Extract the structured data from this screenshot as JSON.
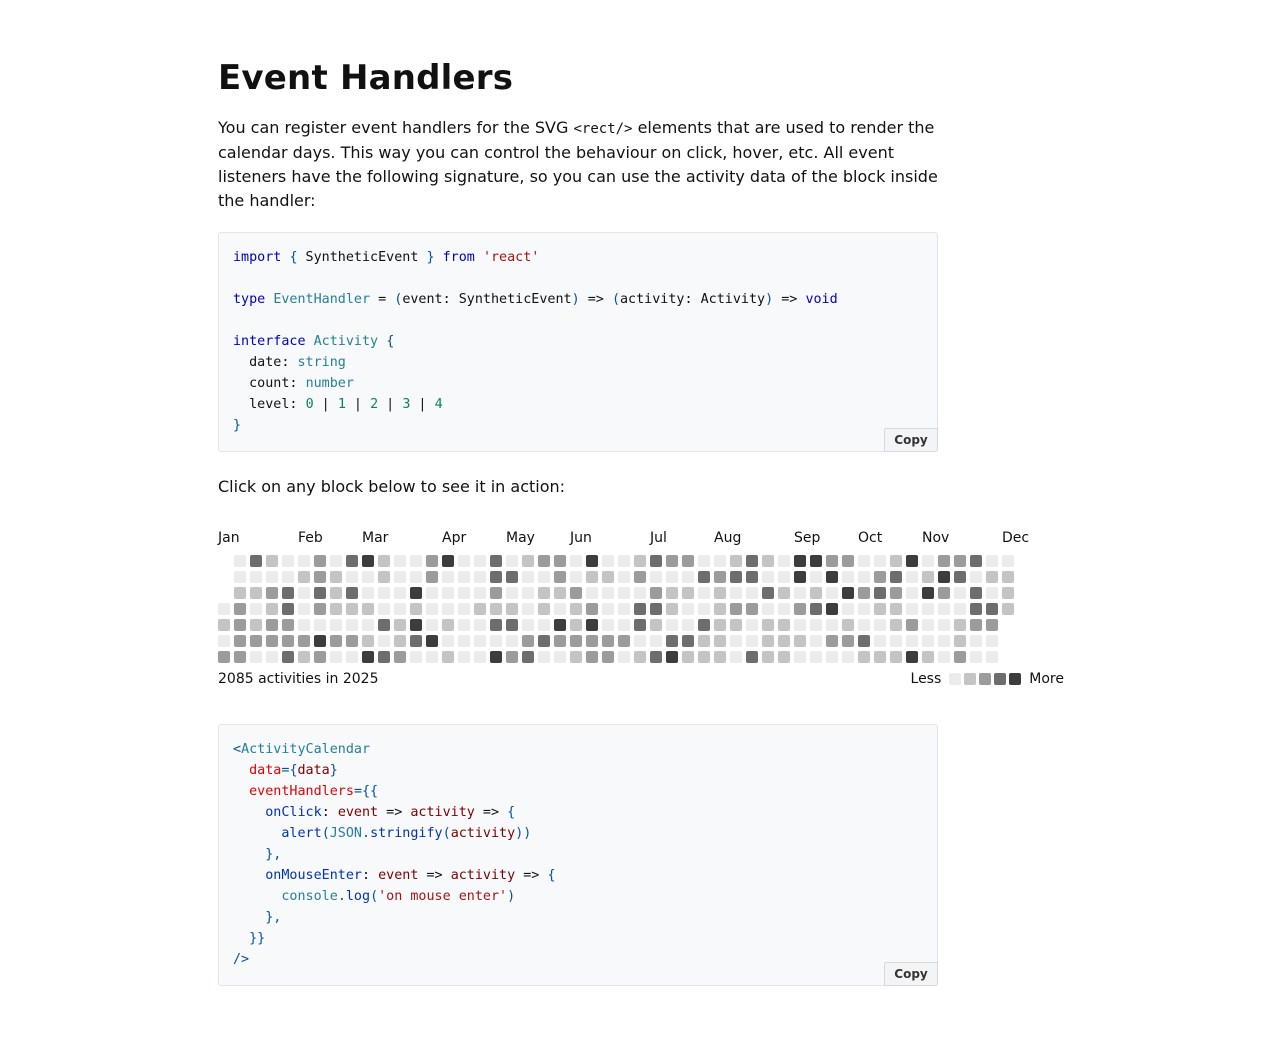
{
  "page": {
    "title": "Event Handlers",
    "intro_part1": "You can register event handlers for the SVG ",
    "intro_code": "<rect/>",
    "intro_part2": " elements that are used to render the calendar days. This way you can control the behaviour on click, hover, etc. All event listeners have the following signature, so you can use the activity data of the block inside the handler:",
    "click_note": "Click on any block below to see it in action:"
  },
  "copy_label": "Copy",
  "code1": {
    "l1_import": "import",
    "l1_lb": "{",
    "l1_name": " SyntheticEvent ",
    "l1_rb": "}",
    "l1_from": "from",
    "l1_str": "'react'",
    "l3_type": "type",
    "l3_name": "EventHandler",
    "l3_eq": " = ",
    "l3_lp": "(",
    "l3_arg": "event: SyntheticEvent",
    "l3_rp": ")",
    "l3_arrow": " => ",
    "l3_lp2": "(",
    "l3_arg2": "activity: Activity",
    "l3_rp2": ")",
    "l3_arrow2": " => ",
    "l3_void": "void",
    "l5_interface": "interface",
    "l5_name": "Activity",
    "l5_lb": "{",
    "l6_key": "  date: ",
    "l6_type": "string",
    "l7_key": "  count: ",
    "l7_type": "number",
    "l8_key": "  level: ",
    "l8_n0": "0",
    "l8_n1": "1",
    "l8_n2": "2",
    "l8_n3": "3",
    "l8_n4": "4",
    "l8_sep": " | ",
    "l9_rb": "}"
  },
  "code2": {
    "l1_lt": "<",
    "l1_comp": "ActivityCalendar",
    "l2_attr": "data",
    "l2_eq": "=",
    "l2_lb": "{",
    "l2_val": "data",
    "l2_rb": "}",
    "l3_attr": "eventHandlers",
    "l3_eq": "=",
    "l3_lb": "{{",
    "l4_key": "onClick",
    "l4_colon": ": ",
    "l4_p1": "event",
    "l4_arrow": " => ",
    "l4_p2": "activity",
    "l4_arrow2": " => ",
    "l4_lb": "{",
    "l5_fn": "alert",
    "l5_lp": "(",
    "l5_obj": "JSON",
    "l5_dot": ".",
    "l5_method": "stringify",
    "l5_lp2": "(",
    "l5_arg": "activity",
    "l5_rp": "))",
    "l6_close": "},",
    "l7_key": "onMouseEnter",
    "l7_colon": ": ",
    "l7_p1": "event",
    "l7_arrow": " => ",
    "l7_p2": "activity",
    "l7_arrow2": " => ",
    "l7_lb": "{",
    "l8_obj": "console",
    "l8_dot": ".",
    "l8_method": "log",
    "l8_lp": "(",
    "l8_str": "'on mouse enter'",
    "l8_rp": ")",
    "l9_close": "},",
    "l10_close": "}}",
    "l11_close": "/>"
  },
  "calendar": {
    "months": [
      "Jan",
      "Feb",
      "Mar",
      "Apr",
      "May",
      "Jun",
      "Jul",
      "Aug",
      "Sep",
      "Oct",
      "Nov",
      "Dec"
    ],
    "month_start_weeks": [
      0,
      5,
      9,
      14,
      18,
      22,
      27,
      31,
      36,
      40,
      44,
      49
    ],
    "level_colors": [
      "#ebebeb",
      "#c4c4c4",
      "#9c9c9c",
      "#6e6e6e",
      "#3d3d3d"
    ],
    "weeks": [
      [
        null,
        null,
        null,
        0,
        1,
        0,
        2
      ],
      [
        0,
        0,
        1,
        2,
        2,
        2,
        2
      ],
      [
        3,
        0,
        1,
        0,
        1,
        2,
        0
      ],
      [
        1,
        0,
        2,
        1,
        2,
        2,
        0
      ],
      [
        0,
        0,
        3,
        3,
        2,
        2,
        3
      ],
      [
        0,
        1,
        0,
        0,
        0,
        2,
        1
      ],
      [
        2,
        2,
        3,
        2,
        0,
        4,
        2
      ],
      [
        0,
        1,
        1,
        1,
        0,
        2,
        0
      ],
      [
        3,
        0,
        3,
        1,
        0,
        2,
        0
      ],
      [
        4,
        0,
        0,
        1,
        0,
        1,
        4
      ],
      [
        1,
        1,
        0,
        0,
        3,
        0,
        3
      ],
      [
        0,
        0,
        0,
        0,
        1,
        1,
        2
      ],
      [
        0,
        0,
        4,
        1,
        4,
        3,
        0
      ],
      [
        2,
        2,
        0,
        0,
        0,
        4,
        0
      ],
      [
        4,
        0,
        0,
        0,
        1,
        0,
        1
      ],
      [
        0,
        0,
        0,
        0,
        0,
        0,
        0
      ],
      [
        0,
        0,
        0,
        1,
        0,
        0,
        0
      ],
      [
        3,
        3,
        2,
        1,
        3,
        0,
        4
      ],
      [
        0,
        3,
        0,
        1,
        3,
        0,
        2
      ],
      [
        1,
        0,
        0,
        0,
        0,
        2,
        3
      ],
      [
        2,
        0,
        1,
        1,
        0,
        3,
        0
      ],
      [
        2,
        2,
        1,
        0,
        4,
        2,
        0
      ],
      [
        0,
        0,
        2,
        1,
        1,
        2,
        1
      ],
      [
        4,
        1,
        0,
        2,
        4,
        2,
        2
      ],
      [
        0,
        1,
        0,
        0,
        0,
        2,
        2
      ],
      [
        0,
        0,
        0,
        0,
        0,
        2,
        0
      ],
      [
        1,
        2,
        0,
        3,
        3,
        0,
        1
      ],
      [
        3,
        0,
        2,
        3,
        1,
        0,
        3
      ],
      [
        2,
        0,
        1,
        1,
        0,
        3,
        4
      ],
      [
        2,
        0,
        1,
        0,
        0,
        3,
        1
      ],
      [
        0,
        3,
        0,
        0,
        3,
        1,
        1
      ],
      [
        0,
        2,
        1,
        1,
        1,
        1,
        1
      ],
      [
        1,
        3,
        0,
        2,
        1,
        0,
        0
      ],
      [
        3,
        3,
        0,
        2,
        0,
        0,
        3
      ],
      [
        1,
        0,
        3,
        0,
        1,
        1,
        1
      ],
      [
        0,
        0,
        1,
        0,
        1,
        1,
        1
      ],
      [
        4,
        4,
        0,
        2,
        0,
        1,
        0
      ],
      [
        4,
        0,
        1,
        3,
        0,
        0,
        0
      ],
      [
        2,
        4,
        0,
        4,
        0,
        2,
        0
      ],
      [
        2,
        0,
        4,
        0,
        1,
        2,
        0
      ],
      [
        0,
        0,
        2,
        0,
        0,
        3,
        1
      ],
      [
        0,
        2,
        3,
        1,
        0,
        0,
        1
      ],
      [
        1,
        3,
        2,
        1,
        1,
        0,
        1
      ],
      [
        4,
        0,
        0,
        0,
        2,
        0,
        4
      ],
      [
        0,
        1,
        4,
        0,
        0,
        0,
        1
      ],
      [
        2,
        4,
        2,
        0,
        0,
        0,
        0
      ],
      [
        2,
        3,
        0,
        0,
        1,
        1,
        2
      ],
      [
        3,
        0,
        3,
        3,
        2,
        0,
        0
      ],
      [
        0,
        1,
        0,
        3,
        2,
        0,
        0
      ],
      [
        0,
        1,
        1,
        1,
        null,
        null,
        null
      ]
    ],
    "total_text": "2085 activities in 2025",
    "legend_less": "Less",
    "legend_more": "More"
  }
}
